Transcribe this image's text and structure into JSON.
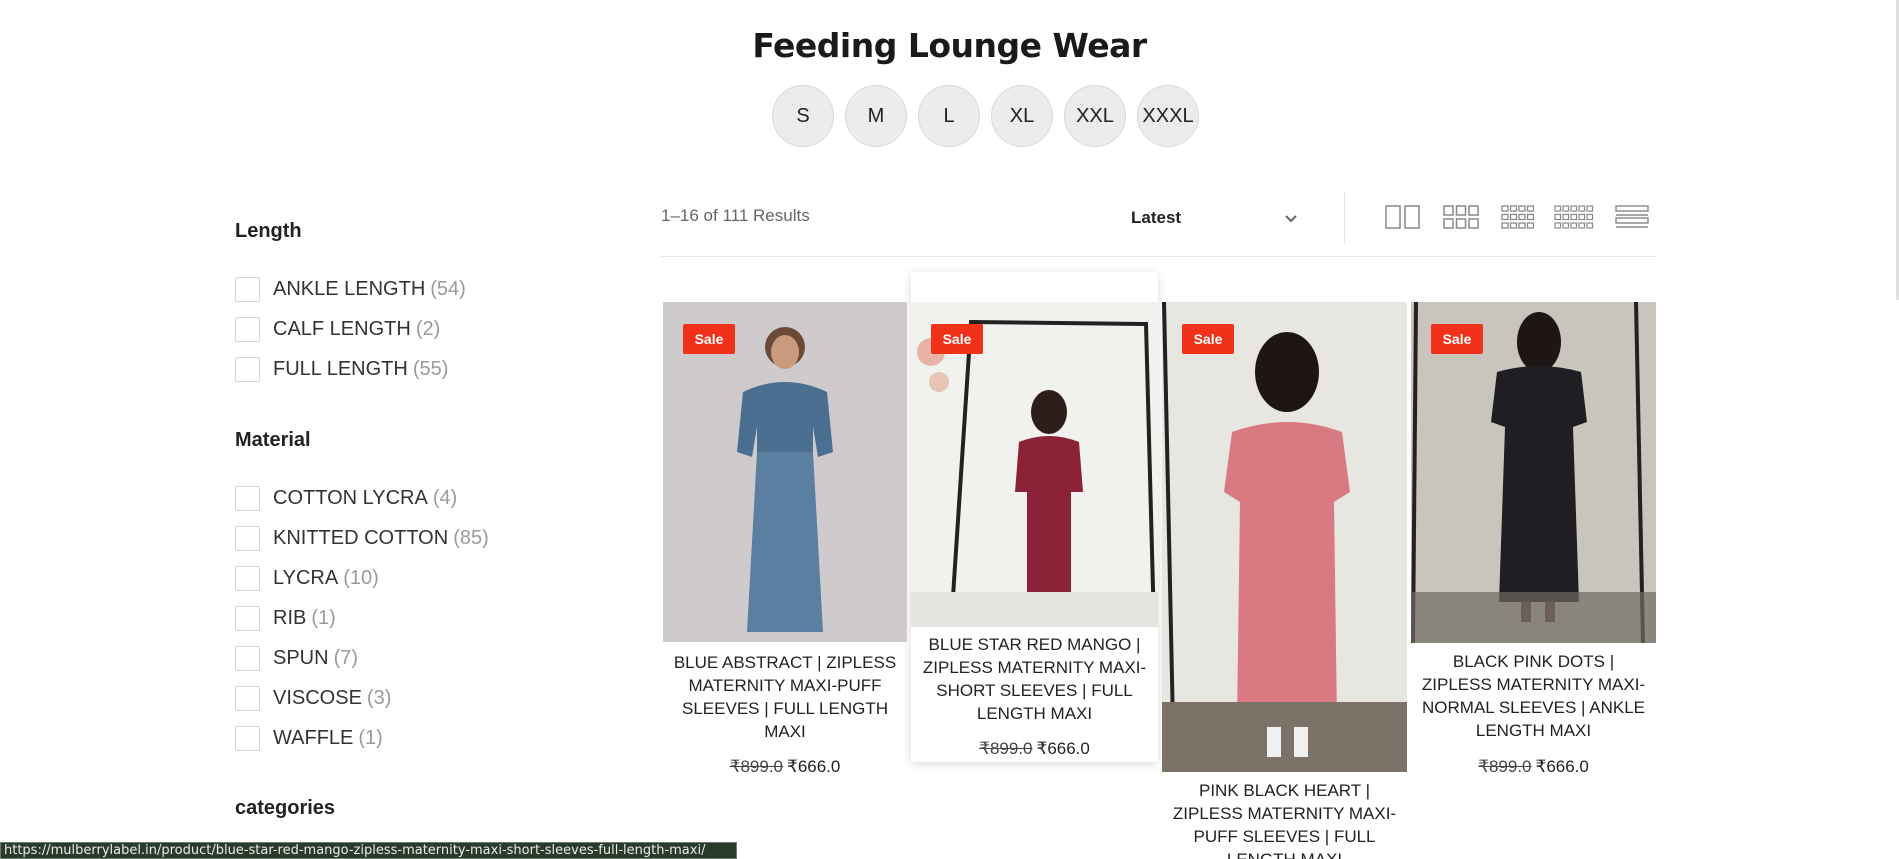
{
  "page": {
    "title": "Feeding Lounge Wear"
  },
  "sizes": [
    "S",
    "M",
    "L",
    "XL",
    "XXL",
    "XXXL"
  ],
  "filters": {
    "length": {
      "heading": "Length",
      "options": [
        {
          "label": "ANKLE LENGTH",
          "count": "(54)"
        },
        {
          "label": "CALF LENGTH",
          "count": "(2)"
        },
        {
          "label": "FULL LENGTH",
          "count": "(55)"
        }
      ]
    },
    "material": {
      "heading": "Material",
      "options": [
        {
          "label": "COTTON LYCRA",
          "count": "(4)"
        },
        {
          "label": "KNITTED COTTON",
          "count": "(85)"
        },
        {
          "label": "LYCRA",
          "count": "(10)"
        },
        {
          "label": "RIB",
          "count": "(1)"
        },
        {
          "label": "SPUN",
          "count": "(7)"
        },
        {
          "label": "VISCOSE",
          "count": "(3)"
        },
        {
          "label": "WAFFLE",
          "count": "(1)"
        }
      ]
    },
    "categories": {
      "heading": "categories"
    }
  },
  "toolbar": {
    "results": "1–16 of 111 Results",
    "sort_label": "Latest",
    "views": [
      "view-2-columns-icon",
      "view-3-columns-icon",
      "view-4-columns-icon",
      "view-5-columns-icon",
      "view-list-icon"
    ]
  },
  "products": [
    {
      "badge": "Sale",
      "title": "BLUE ABSTRACT | ZIPLESS MATERNITY MAXI-PUFF SLEEVES | FULL LENGTH MAXI",
      "old_price": "₹899.0",
      "new_price": "₹666.0"
    },
    {
      "badge": "Sale",
      "title": "BLUE STAR RED MANGO | ZIPLESS MATERNITY MAXI-SHORT SLEEVES | FULL LENGTH MAXI",
      "old_price": "₹899.0",
      "new_price": "₹666.0"
    },
    {
      "badge": "Sale",
      "title": "PINK BLACK HEART | ZIPLESS MATERNITY MAXI-PUFF SLEEVES | FULL LENGTH MAXI",
      "old_price": "",
      "new_price": ""
    },
    {
      "badge": "Sale",
      "title": "BLACK PINK DOTS | ZIPLESS MATERNITY MAXI-NORMAL SLEEVES | ANKLE LENGTH MAXI",
      "old_price": "₹899.0",
      "new_price": "₹666.0"
    }
  ],
  "status_bar": {
    "url": "https://mulberrylabel.in/product/blue-star-red-mango-zipless-maternity-maxi-short-sleeves-full-length-maxi/"
  },
  "colors": {
    "sale_badge": "#f2311a",
    "pill_bg": "#ececec"
  }
}
